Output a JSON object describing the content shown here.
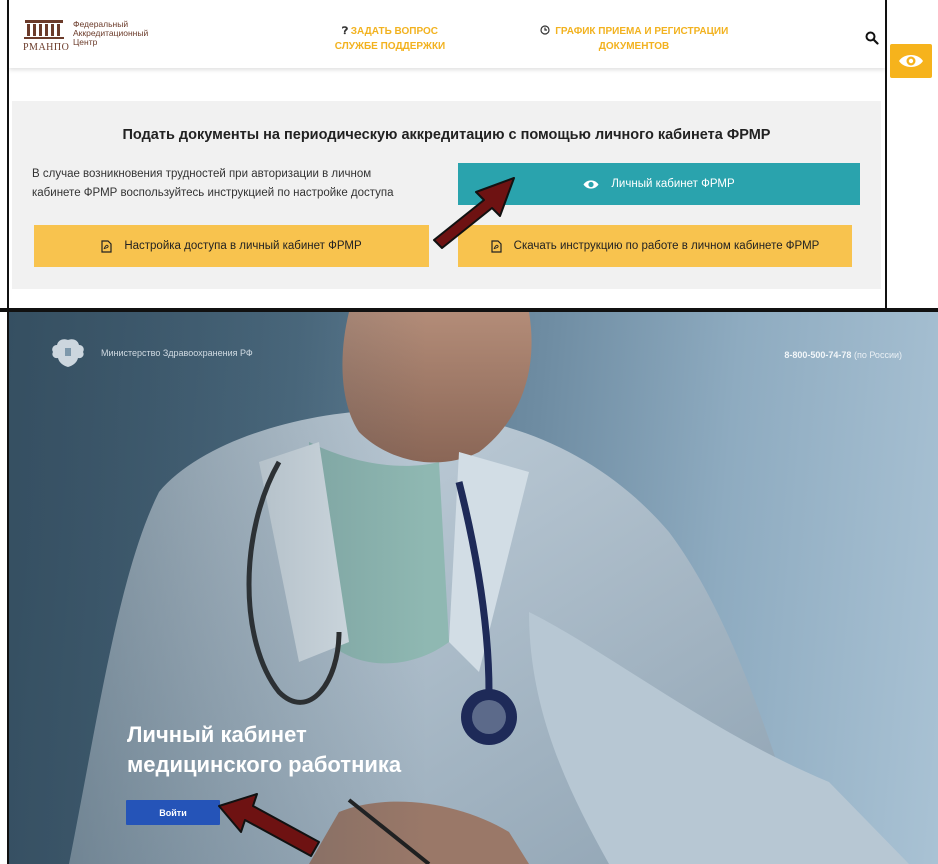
{
  "header": {
    "logo": {
      "line1": "Федеральный",
      "line2": "Аккредитационный",
      "line3": "Центр",
      "abbr": "РМАНПО"
    },
    "support_link": {
      "line1": "ЗАДАТЬ ВОПРОС",
      "line2": "СЛУЖБЕ ПОДДЕРЖКИ"
    },
    "schedule_link": {
      "line1": "ГРАФИК ПРИЕМА И РЕГИСТРАЦИИ",
      "line2": "ДОКУМЕНТОВ"
    }
  },
  "section": {
    "title": "Подать документы на периодическую аккредитацию с помощью личного кабинета ФРМР",
    "description_line1": "В случае возникновения трудностей при авторизации в личном",
    "description_line2": "кабинете ФРМР воспользуйтесь инструкцией по настройке доступа",
    "cabinet_button": "Личный кабинет ФРМР",
    "access_button": "Настройка доступа в личный кабинет ФРМР",
    "download_button": "Скачать инструкцию по работе в личном кабинете ФРМР"
  },
  "login_page": {
    "ministry": "Министерство Здравоохранения РФ",
    "phone": "8-800-500-74-78",
    "phone_note": "(по России)",
    "hero_line1": "Личный кабинет",
    "hero_line2": "медицинского работника",
    "login_button": "Войти"
  },
  "colors": {
    "accent_yellow": "#f8c34e",
    "teal": "#2aa3ad",
    "login_blue": "#2554b8",
    "arrow": "#6e1212"
  },
  "icons": [
    "question-circle-icon",
    "clock-icon",
    "search-icon",
    "eye-icon",
    "pdf-file-icon",
    "emblem-icon",
    "arrow-icon"
  ]
}
